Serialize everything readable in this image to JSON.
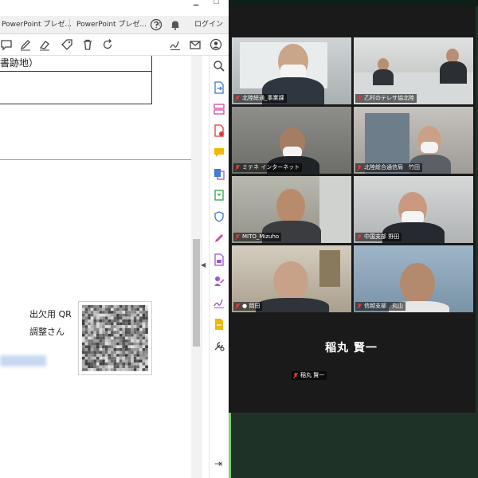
{
  "pdf_viewer": {
    "tabs": [
      {
        "label": "PowerPoint プレゼ..."
      },
      {
        "label": "PowerPoint プレゼ..."
      }
    ],
    "tab_close_glyph": "×",
    "login_label": "ログイン",
    "header_icons": [
      "help-icon",
      "bell-icon"
    ],
    "toolbar_icons": [
      "comment-icon",
      "pen-icon",
      "eraser-icon",
      "tag-icon",
      "delete-icon",
      "rotate-icon",
      "sign-icon",
      "mail-icon",
      "account-icon"
    ],
    "rail_icons": [
      "zoom-icon",
      "export-pdf-icon",
      "organize-icon",
      "create-pdf-icon",
      "comment-icon",
      "combine-icon",
      "compress-icon",
      "protect-icon",
      "edit-icon",
      "pdf-icon",
      "fill-sign-icon",
      "sign-icon",
      "stamp-icon",
      "tools-icon"
    ],
    "rail_expand_glyph": "⇥",
    "collapse_glyph": "◀",
    "document": {
      "address_fragment": "書跡地）",
      "qr_label_line1": "出欠用 QR",
      "qr_label_line2": "調整さん"
    }
  },
  "meeting": {
    "participants": [
      {
        "name": "北陸総通_事業課",
        "active": true
      },
      {
        "name": "乙村のテレサ協北陸",
        "active": false
      },
      {
        "name": "ミテネ インターネット",
        "active": false
      },
      {
        "name": "北陸総合通信局　竹田",
        "active": false
      },
      {
        "name": "MITO_Mizuho",
        "active": false
      },
      {
        "name": "中国支部 野田",
        "active": false
      },
      {
        "name": "● 岡田",
        "active": false
      },
      {
        "name": "信越支部　丸山",
        "active": false
      }
    ],
    "active_speaker": {
      "display_name": "稲丸 賢一",
      "tag": "稲丸 賢一"
    },
    "colors": {
      "window_bg": "#1a1a1a",
      "desktop_bg": "#1f3228",
      "active_outline": "#c7e85a",
      "muted_mic": "#e03a3a"
    }
  }
}
